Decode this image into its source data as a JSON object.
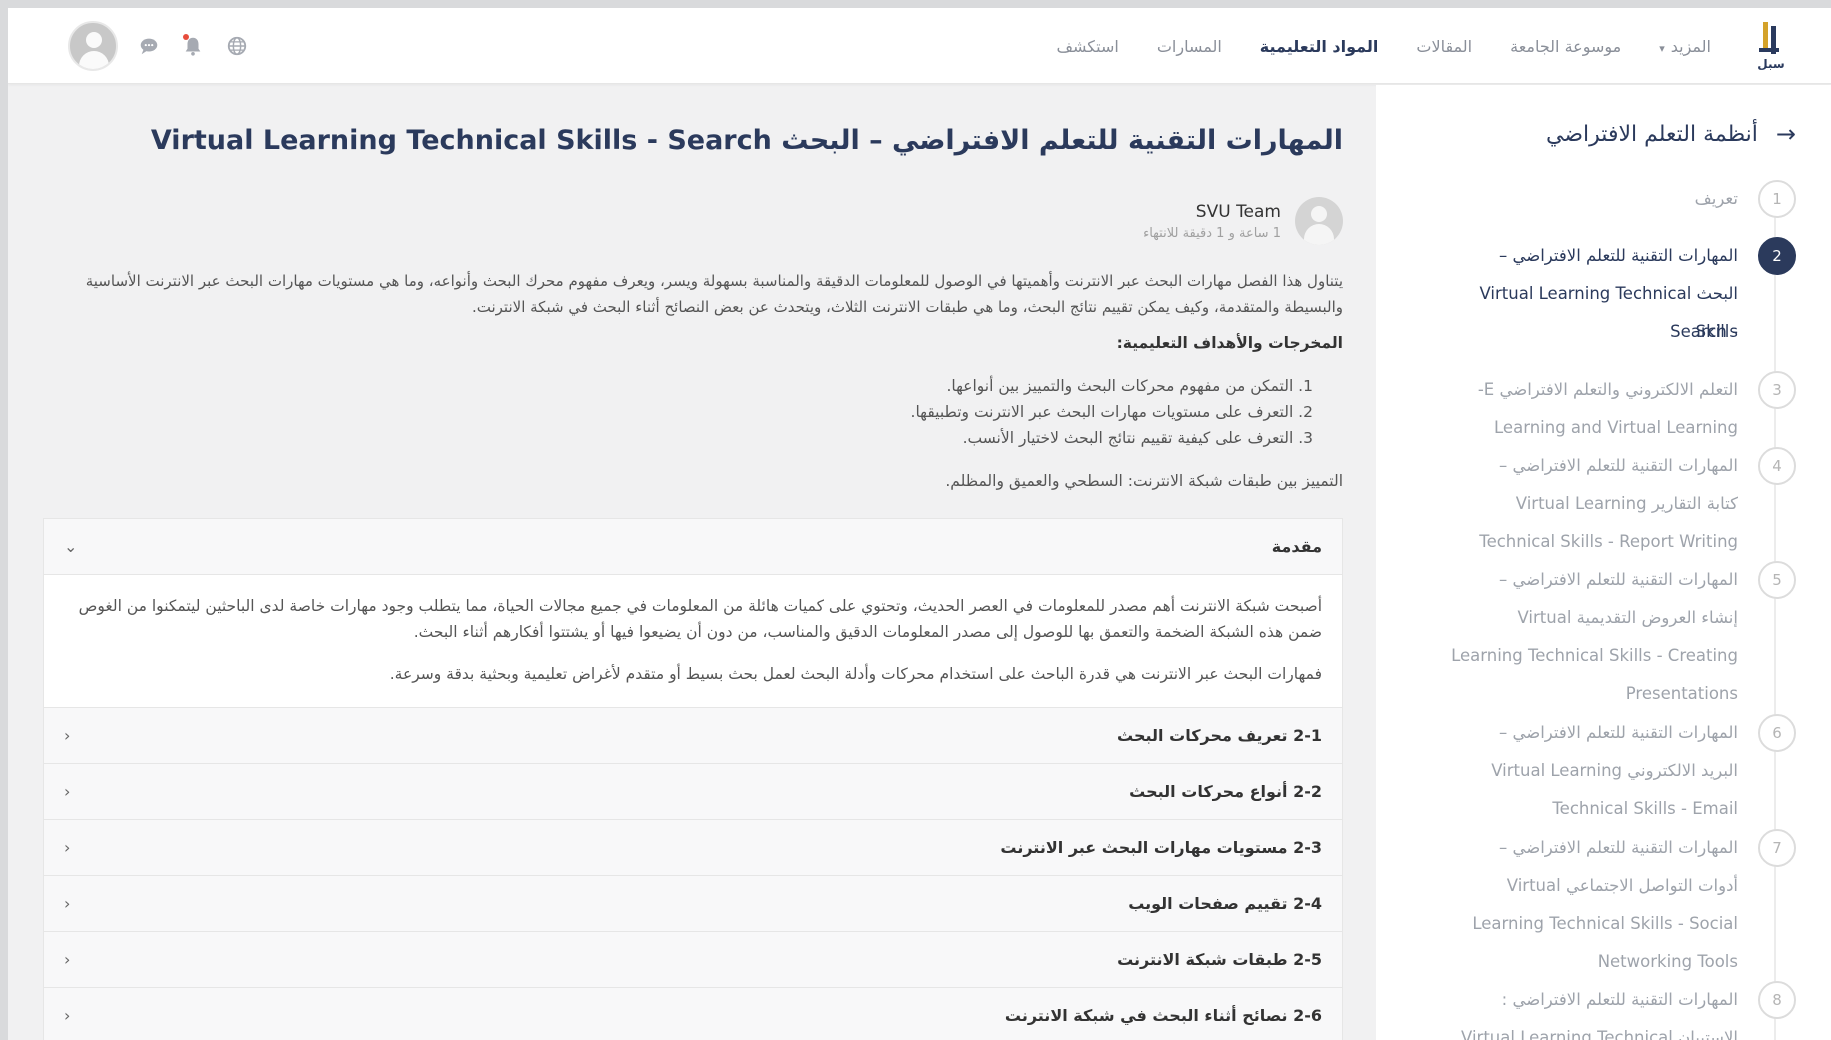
{
  "topbar": {
    "logo_text": "سبل",
    "nav": [
      {
        "label": "استكشف",
        "active": false
      },
      {
        "label": "المسارات",
        "active": false
      },
      {
        "label": "المواد التعليمية",
        "active": true
      },
      {
        "label": "المقالات",
        "active": false
      },
      {
        "label": "موسوعة الجامعة",
        "active": false
      },
      {
        "label": "المزيد",
        "active": false,
        "dropdown": true
      }
    ],
    "icons": [
      "globe-icon",
      "bell-icon",
      "chat-icon"
    ]
  },
  "sidebar": {
    "title": "أنظمة التعلم الافتراضي",
    "steps": [
      {
        "num": "1",
        "lines": [
          "تعريف"
        ],
        "active": false
      },
      {
        "num": "2",
        "lines": [
          "المهارات التقنية للتعلم الافتراضي –",
          "البحث Virtual Learning Technical Skills",
          "- Search"
        ],
        "active": true
      },
      {
        "num": "3",
        "lines": [
          "التعلم الالكتروني والتعلم الافتراضي E-",
          "Learning and Virtual Learning"
        ],
        "active": false
      },
      {
        "num": "4",
        "lines": [
          "المهارات التقنية للتعلم الافتراضي –",
          "كتابة التقارير Virtual Learning",
          "Technical Skills - Report Writing"
        ],
        "active": false
      },
      {
        "num": "5",
        "lines": [
          "المهارات التقنية للتعلم الافتراضي –",
          "إنشاء العروض التقديمية Virtual",
          "Learning Technical Skills - Creating",
          "Presentations"
        ],
        "active": false
      },
      {
        "num": "6",
        "lines": [
          "المهارات التقنية للتعلم الافتراضي –",
          "البريد الالكتروني Virtual Learning",
          "Technical Skills - Email"
        ],
        "active": false
      },
      {
        "num": "7",
        "lines": [
          "المهارات التقنية للتعلم الافتراضي –",
          "أدوات التواصل الاجتماعي Virtual",
          "Learning Technical Skills - Social",
          "Networking Tools"
        ],
        "active": false
      },
      {
        "num": "8",
        "lines": [
          "المهارات التقنية للتعلم الافتراضي :",
          "الاستبيان Virtual Learning Technical"
        ],
        "active": false
      }
    ]
  },
  "main": {
    "title": "المهارات التقنية للتعلم الافتراضي – البحث Virtual Learning Technical Skills - Search",
    "author_name": "SVU Team",
    "duration": "1 ساعة و 1 دقيقة للانتهاء",
    "description": "يتناول هذا الفصل مهارات البحث عبر الانترنت وأهميتها في الوصول للمعلومات الدقيقة والمناسبة بسهولة ويسر، ويعرف مفهوم محرك البحث وأنواعه، وما هي مستويات مهارات البحث عبر الانترنت الأساسية والبسيطة والمتقدمة، وكيف يمكن تقييم نتائج البحث، وما هي طبقات الانترنت الثلاث، ويتحدث عن بعض النصائح أثناء البحث في شبكة الانترنت.",
    "outcomes_title": "المخرجات والأهداف التعليمية:",
    "outcomes": [
      "1. التمكن من مفهوم محركات البحث والتمييز بين أنواعها.",
      "2. التعرف على مستويات مهارات البحث عبر الانترنت وتطبيقها.",
      "3. التعرف على كيفية تقييم نتائج البحث لاختيار الأنسب."
    ],
    "extra_line": "التمييز بين طبقات شبكة الانترنت: السطحي والعميق والمظلم.",
    "accordion": {
      "open_section": {
        "title": "مقدمة",
        "paragraphs": [
          "أصبحت شبكة الانترنت أهم مصدر للمعلومات في العصر الحديث، وتحتوي على كميات هائلة من المعلومات في جميع مجالات الحياة، مما يتطلب وجود مهارات خاصة لدى الباحثين ليتمكنوا من الغوص ضمن هذه الشبكة الضخمة والتعمق بها للوصول إلى مصدر المعلومات الدقيق والمناسب، من دون أن يضيعوا فيها أو يشتتوا أفكارهم أثناء البحث.",
          "فمهارات البحث عبر الانترنت هي قدرة الباحث على استخدام محركات وأدلة البحث لعمل بحث بسيط أو متقدم لأغراض تعليمية وبحثية بدقة وسرعة."
        ]
      },
      "sections": [
        "2-1 تعريف محركات البحث",
        "2-2 أنواع محركات البحث",
        "2-3 مستويات مهارات البحث عبر الانترنت",
        "2-4 تقييم صفحات الويب",
        "2-5 طبقات شبكة الانترنت",
        "2-6 نصائح أثناء البحث في شبكة الانترنت"
      ]
    }
  },
  "colors": {
    "primary": "#2b3a5c",
    "accent": "#d4a22a",
    "muted": "#9ea3ab",
    "notification": "#e74c3c"
  }
}
